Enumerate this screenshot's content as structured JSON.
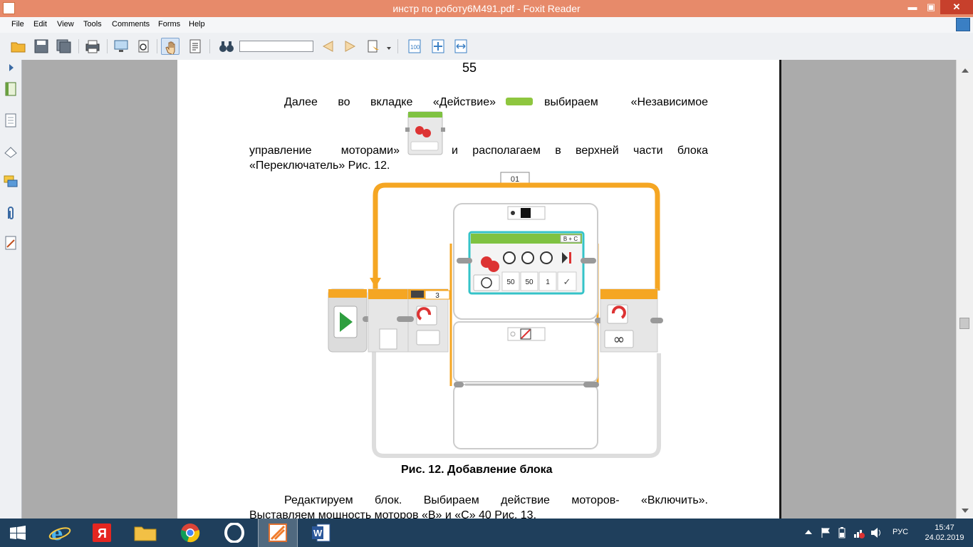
{
  "window": {
    "title": "инстр по роботу6М491.pdf - Foxit Reader",
    "minimize": "▬",
    "maximize": "▣",
    "close": "✕"
  },
  "menu": [
    "File",
    "Edit",
    "View",
    "Tools",
    "Comments",
    "Forms",
    "Help"
  ],
  "toolbar": {
    "find_value": ""
  },
  "document": {
    "page_number": "55",
    "para1_line1": "Далее во вкладке «Действие»",
    "para1_line1_end": "выбираем «Независимое",
    "para1_line2_start": "управление моторами»",
    "para1_line2_end": "и располагаем в верхней части блока",
    "para1_line3": "«Переключатель» Рис. 12.",
    "figure": {
      "tab_label": "01",
      "loop_count": "3",
      "port_label": "B + C",
      "values": [
        "50",
        "50",
        "1"
      ],
      "checkmark": "✓",
      "infinity": "∞"
    },
    "caption": "Рис. 12. Добавление блока",
    "para2_line1": "Редактируем блок. Выбираем действие моторов- «Включить».",
    "para2_line2": "Выставляем мощность моторов «В» и «С» 40 Рис. 13."
  },
  "taskbar": {
    "language": "РУС",
    "time": "15:47",
    "date": "24.02.2019"
  }
}
